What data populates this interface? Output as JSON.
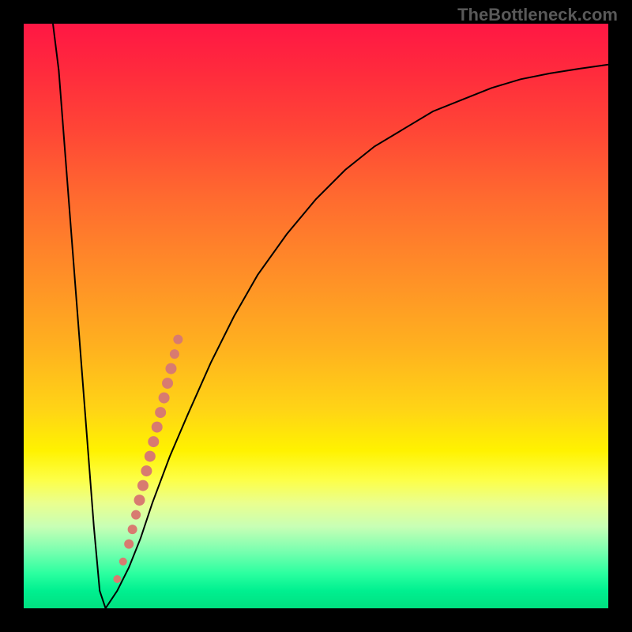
{
  "watermark": "TheBottleneck.com",
  "chart_data": {
    "type": "line",
    "title": "",
    "xlabel": "",
    "ylabel": "",
    "xlim": [
      0,
      100
    ],
    "ylim": [
      0,
      100
    ],
    "grid": false,
    "series": [
      {
        "name": "bottleneck-curve",
        "color": "#000000",
        "x": [
          5,
          6,
          7,
          8,
          9,
          10,
          11,
          12,
          13,
          14,
          16,
          18,
          20,
          22,
          25,
          28,
          32,
          36,
          40,
          45,
          50,
          55,
          60,
          65,
          70,
          75,
          80,
          85,
          90,
          95,
          100
        ],
        "y": [
          100,
          92,
          79,
          66,
          53,
          40,
          27,
          14,
          3,
          0,
          3,
          7,
          12,
          18,
          26,
          33,
          42,
          50,
          57,
          64,
          70,
          75,
          79,
          82,
          85,
          87,
          89,
          90.5,
          91.5,
          92.3,
          93
        ]
      }
    ],
    "highlight_points": {
      "name": "salmon-dot-band",
      "color": "#d87b70",
      "points": [
        {
          "x": 16.0,
          "y": 5.0,
          "r": 5
        },
        {
          "x": 17.0,
          "y": 8.0,
          "r": 5
        },
        {
          "x": 18.0,
          "y": 11.0,
          "r": 6
        },
        {
          "x": 18.6,
          "y": 13.5,
          "r": 6
        },
        {
          "x": 19.2,
          "y": 16.0,
          "r": 6
        },
        {
          "x": 19.8,
          "y": 18.5,
          "r": 7
        },
        {
          "x": 20.4,
          "y": 21.0,
          "r": 7
        },
        {
          "x": 21.0,
          "y": 23.5,
          "r": 7
        },
        {
          "x": 21.6,
          "y": 26.0,
          "r": 7
        },
        {
          "x": 22.2,
          "y": 28.5,
          "r": 7
        },
        {
          "x": 22.8,
          "y": 31.0,
          "r": 7
        },
        {
          "x": 23.4,
          "y": 33.5,
          "r": 7
        },
        {
          "x": 24.0,
          "y": 36.0,
          "r": 7
        },
        {
          "x": 24.6,
          "y": 38.5,
          "r": 7
        },
        {
          "x": 25.2,
          "y": 41.0,
          "r": 7
        },
        {
          "x": 25.8,
          "y": 43.5,
          "r": 6
        },
        {
          "x": 26.4,
          "y": 46.0,
          "r": 6
        }
      ]
    }
  }
}
